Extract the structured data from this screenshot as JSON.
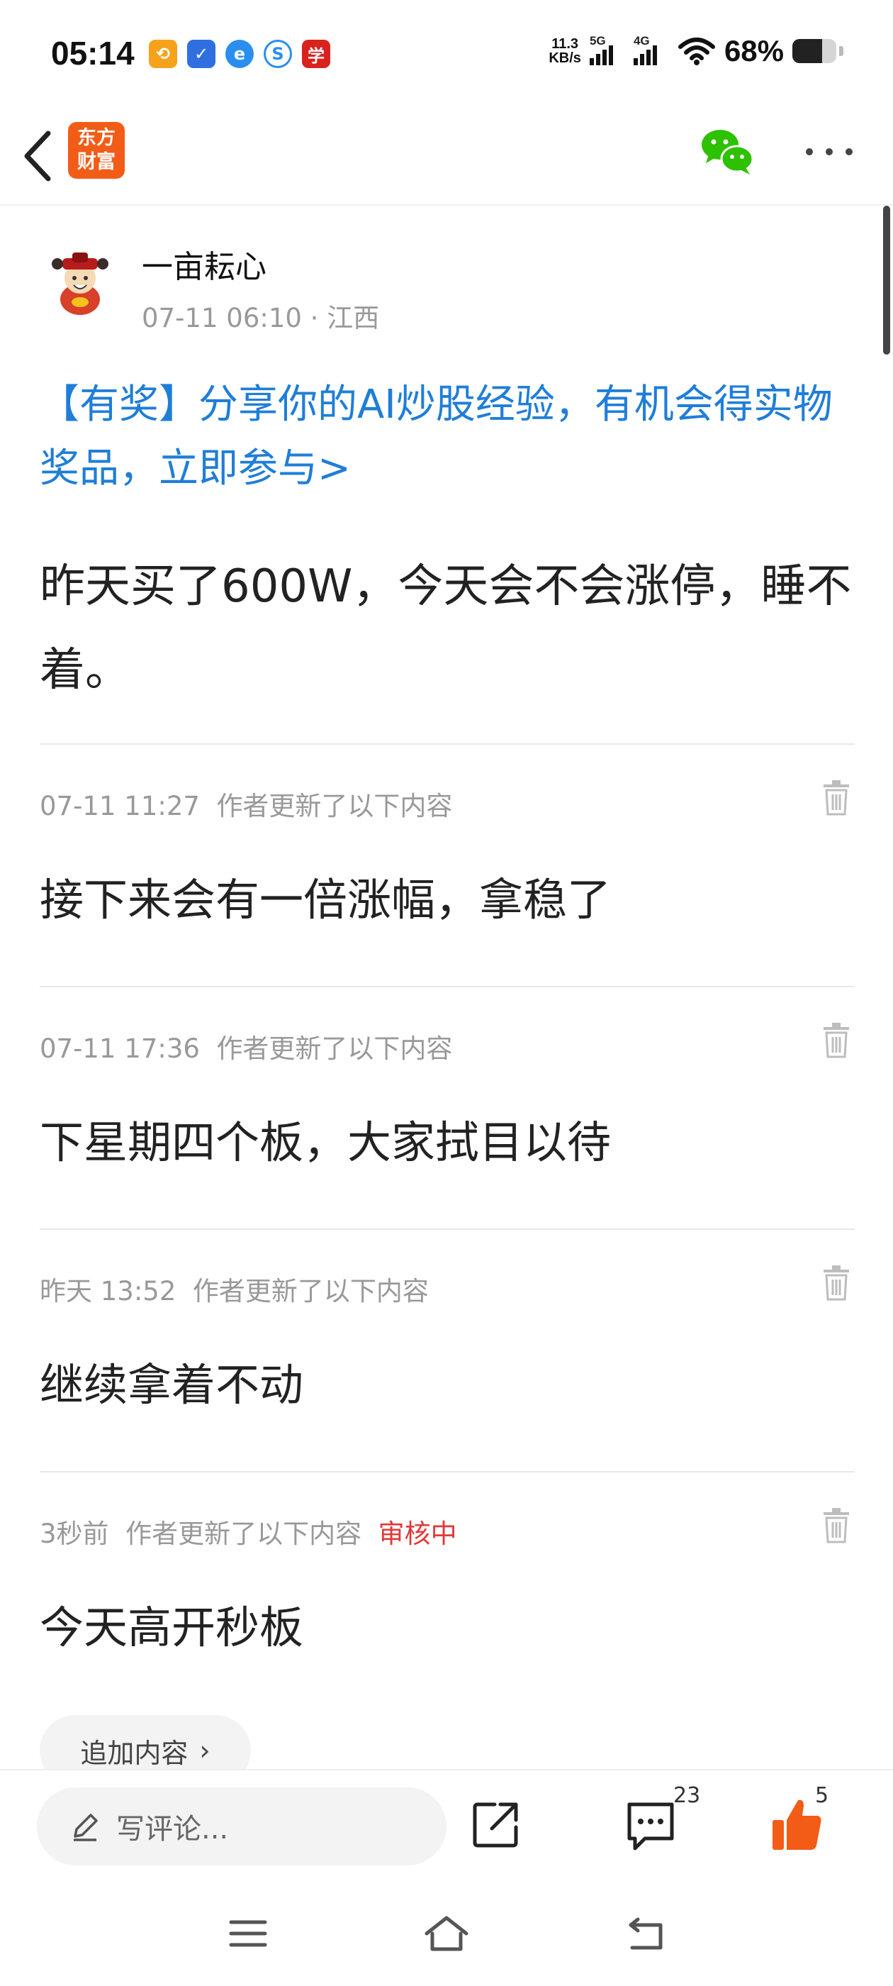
{
  "status_bar": {
    "time": "05:14",
    "net_speed_value": "11.3",
    "net_speed_unit": "KB/s",
    "signal_1_label": "5G",
    "signal_2_label": "4G",
    "battery_percent": "68%",
    "battery_level": 0.68,
    "app_icons": [
      "orange-app-icon",
      "shield-app-icon",
      "blue-circle-app-icon",
      "swirl-app-icon",
      "red-app-icon"
    ]
  },
  "nav": {
    "logo_line1": "东方",
    "logo_line2": "财富",
    "brand_color": "#f25c17",
    "wechat_color": "#2dc100"
  },
  "author": {
    "name": "一亩耘心",
    "timestamp": "07-11 06:10",
    "separator": "·",
    "location": "江西"
  },
  "promo": {
    "text": "【有奖】分享你的AI炒股经验，有机会得实物奖品，立即参与>",
    "color": "#1f7ed8"
  },
  "post": {
    "body": "昨天买了600W，今天会不会涨停，睡不着。"
  },
  "updates": [
    {
      "time": "07-11 11:27",
      "label": "作者更新了以下内容",
      "status": "",
      "text": "接下来会有一倍涨幅，拿稳了"
    },
    {
      "time": "07-11 17:36",
      "label": "作者更新了以下内容",
      "status": "",
      "text": "下星期四个板，大家拭目以待"
    },
    {
      "time": "昨天 13:52",
      "label": "作者更新了以下内容",
      "status": "",
      "text": "继续拿着不动"
    },
    {
      "time": "3秒前",
      "label": "作者更新了以下内容",
      "status": "审核中",
      "text": "今天高开秒板"
    }
  ],
  "review_status_color": "#e03a3a",
  "append": {
    "label": "追加内容",
    "chevron": "›"
  },
  "action_bar": {
    "comment_placeholder": "写评论...",
    "comments_count": "23",
    "likes_count": "5",
    "like_color": "#f25c17"
  }
}
